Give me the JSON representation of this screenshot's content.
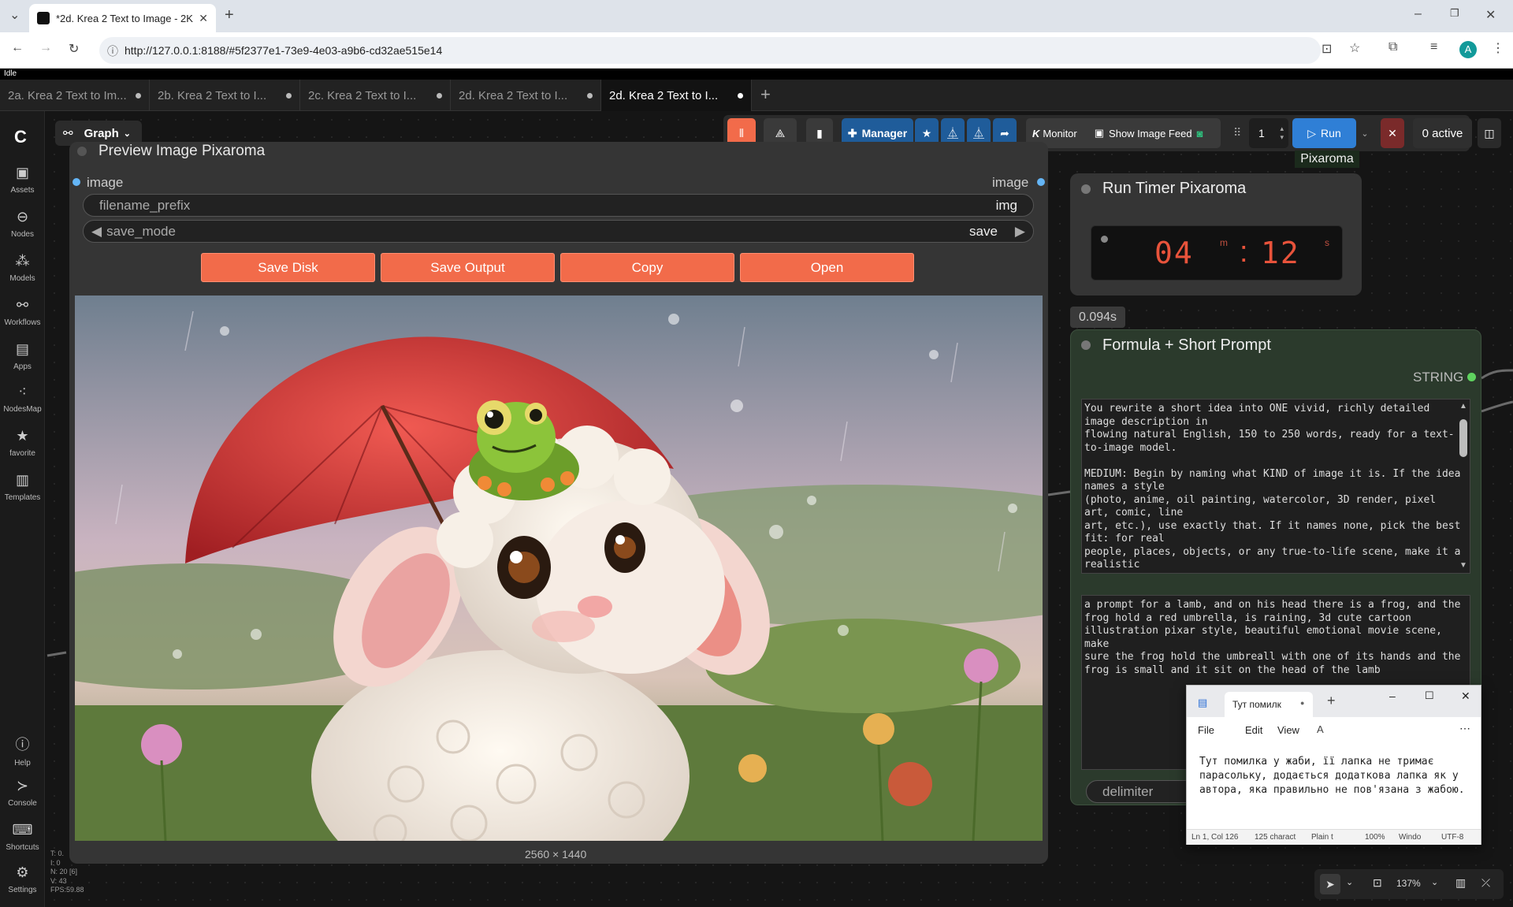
{
  "browser": {
    "tab_title": "*2d. Krea 2 Text to Image - 2K",
    "url": "http://127.0.0.1:8188/#5f2377e1-73e9-4e03-a9b6-cd32ae515e14",
    "profile_initial": "A"
  },
  "app": {
    "status": "Idle",
    "workflow_tabs": [
      {
        "label": "2a. Krea 2 Text to Im..."
      },
      {
        "label": "2b. Krea 2 Text to I..."
      },
      {
        "label": "2c. Krea 2 Text to I..."
      },
      {
        "label": "2d. Krea 2 Text to I..."
      },
      {
        "label": "2d. Krea 2 Text to I..."
      }
    ],
    "graph_label": "Graph"
  },
  "sidebar": {
    "items": [
      {
        "label": "Assets",
        "icon": "image-icon"
      },
      {
        "label": "Nodes",
        "icon": "nodes-icon"
      },
      {
        "label": "Models",
        "icon": "cube-icon"
      },
      {
        "label": "Workflows",
        "icon": "workflow-icon"
      },
      {
        "label": "Apps",
        "icon": "apps-icon"
      },
      {
        "label": "NodesMap",
        "icon": "nodesmap-icon"
      },
      {
        "label": "favorite",
        "icon": "star-icon"
      },
      {
        "label": "Templates",
        "icon": "templates-icon"
      }
    ],
    "bottom": [
      {
        "label": "Help",
        "icon": "help-icon"
      },
      {
        "label": "Console",
        "icon": "console-icon"
      },
      {
        "label": "Shortcuts",
        "icon": "keyboard-icon"
      },
      {
        "label": "Settings",
        "icon": "gear-icon"
      }
    ]
  },
  "toolbar": {
    "manager": "Manager",
    "monitor": "Monitor",
    "monitor_k": "K",
    "image_feed": "Show Image Feed",
    "batch_count": "1",
    "run": "Run",
    "active": "0 active",
    "pixaroma_tag": "Pixaroma"
  },
  "preview_node": {
    "title": "Preview Image Pixaroma",
    "input_label": "image",
    "output_label": "image",
    "filename_prefix_label": "filename_prefix",
    "filename_prefix_value": "img",
    "save_mode_label": "save_mode",
    "save_mode_value": "save",
    "buttons": [
      "Save Disk",
      "Save Output",
      "Copy",
      "Open"
    ],
    "dimensions": "2560 × 1440"
  },
  "timer_node": {
    "title": "Run Timer Pixaroma",
    "minutes": "04",
    "minutes_unit": "m",
    "seconds": "12",
    "seconds_unit": "s",
    "exec_time": "0.094s"
  },
  "formula_node": {
    "title": "Formula + Short Prompt",
    "output_type": "STRING",
    "formula_text": "You rewrite a short idea into ONE vivid, richly detailed\nimage description in\nflowing natural English, 150 to 250 words, ready for a text-\nto-image model.\n\nMEDIUM: Begin by naming what KIND of image it is. If the idea\nnames a style\n(photo, anime, oil painting, watercolor, 3D render, pixel\nart, comic, line\nart, etc.), use exactly that. If it names none, pick the best\nfit: for real\npeople, places, objects, or any true-to-life scene, make it a\nrealistic",
    "prompt_text": "a prompt for a lamb, and on his head there is a frog, and the\nfrog hold a red umbrella, is raining, 3d cute cartoon\nillustration pixar style, beautiful emotional movie scene, make\nsure the frog hold the umbreall with one of its hands and the\nfrog is small and it sit on the head of the lamb",
    "delimiter_label": "delimiter"
  },
  "notepad": {
    "tab_title": "Тут помилк",
    "menu": [
      "File",
      "Edit",
      "View"
    ],
    "text": "Тут помилка у жаби, її лапка не тримає\nпарасольку, додається додаткова лапка як у\nавтора, яка правильно не пов'язана з жабою.",
    "status": [
      "Ln 1, Col 126",
      "125 charact",
      "Plain t",
      "100%",
      "Windo",
      "UTF-8"
    ]
  },
  "stats": {
    "lines": [
      "T: 0.",
      "I: 0",
      "N: 20 [6]",
      "V: 43",
      "FPS:59.88"
    ]
  },
  "bottom_controls": {
    "zoom": "137%"
  },
  "colors": {
    "accent_orange": "#f26b4a",
    "run_blue": "#2f7fd6",
    "manager_blue": "#1f5c9a",
    "timer_digits": "#e8533b",
    "formula_node_bg": "#2b3a2c"
  }
}
